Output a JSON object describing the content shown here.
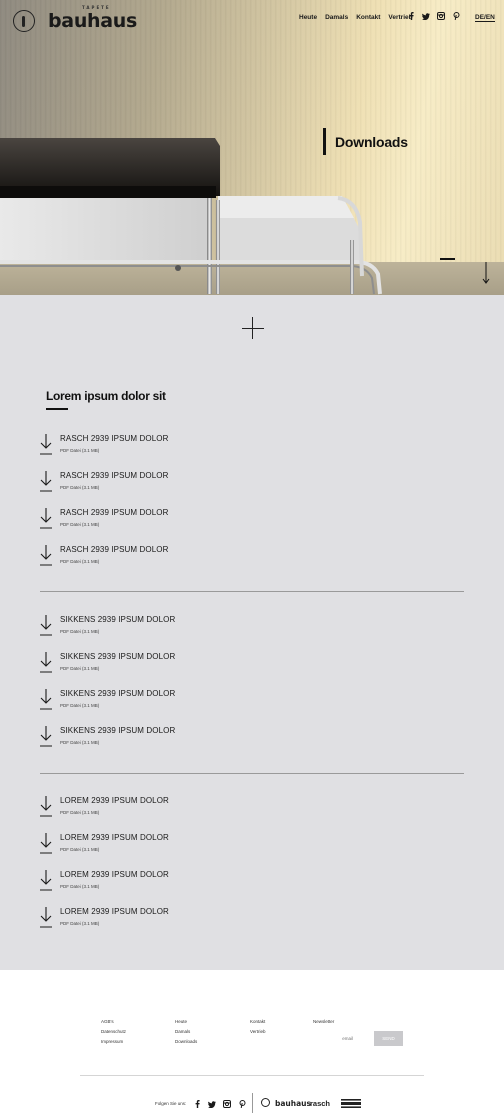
{
  "brand": {
    "name": "bauhaus",
    "tagline": "TAPETE"
  },
  "nav": [
    {
      "label": "Heute"
    },
    {
      "label": "Damals"
    },
    {
      "label": "Kontakt"
    },
    {
      "label": "Vertrieb"
    }
  ],
  "social": [
    "facebook-icon",
    "twitter-icon",
    "instagram-icon",
    "pinterest-icon"
  ],
  "language": "DE/EN",
  "hero": {
    "title": "Downloads"
  },
  "section": {
    "title": "Lorem ipsum dolor sit"
  },
  "downloads": [
    {
      "items": [
        {
          "name": "RASCH 2939 IPSUM DOLOR",
          "meta": "PDF Datei (3.1 MB)"
        },
        {
          "name": "RASCH 2939 IPSUM DOLOR",
          "meta": "PDF Datei (3.1 MB)"
        },
        {
          "name": "RASCH 2939 IPSUM DOLOR",
          "meta": "PDF Datei (3.1 MB)"
        },
        {
          "name": "RASCH 2939 IPSUM DOLOR",
          "meta": "PDF Datei (3.1 MB)"
        }
      ]
    },
    {
      "items": [
        {
          "name": "SIKKENS 2939 IPSUM DOLOR",
          "meta": "PDF Datei (3.1 MB)"
        },
        {
          "name": "SIKKENS 2939 IPSUM DOLOR",
          "meta": "PDF Datei (3.1 MB)"
        },
        {
          "name": "SIKKENS 2939 IPSUM DOLOR",
          "meta": "PDF Datei (3.1 MB)"
        },
        {
          "name": "SIKKENS 2939 IPSUM DOLOR",
          "meta": "PDF Datei (3.1 MB)"
        }
      ]
    },
    {
      "items": [
        {
          "name": "LOREM 2939 IPSUM DOLOR",
          "meta": "PDF Datei (3.1 MB)"
        },
        {
          "name": "LOREM 2939 IPSUM DOLOR",
          "meta": "PDF Datei (3.1 MB)"
        },
        {
          "name": "LOREM 2939 IPSUM DOLOR",
          "meta": "PDF Datei (3.1 MB)"
        },
        {
          "name": "LOREM 2939 IPSUM DOLOR",
          "meta": "PDF Datei (3.1 MB)"
        }
      ]
    }
  ],
  "footer": {
    "col1": [
      "AGB's",
      "Datenschutz",
      "Impressum"
    ],
    "col2": [
      "Heute",
      "Damals",
      "Downloads"
    ],
    "col3": [
      "Kontakt",
      "Vertrieb"
    ],
    "newsletter_label": "Newsletter",
    "email_placeholder": "email",
    "send_label": "SEND",
    "follow_label": "Folgen Sie uns:",
    "brands": {
      "bauhaus": "bauhaus",
      "rasch": "rasch",
      "sikkens": "sikkens"
    }
  },
  "colors": {
    "content_bg": "#e0e0e3",
    "divider": "#9a9a9a",
    "send_button": "#c9c9cc"
  }
}
